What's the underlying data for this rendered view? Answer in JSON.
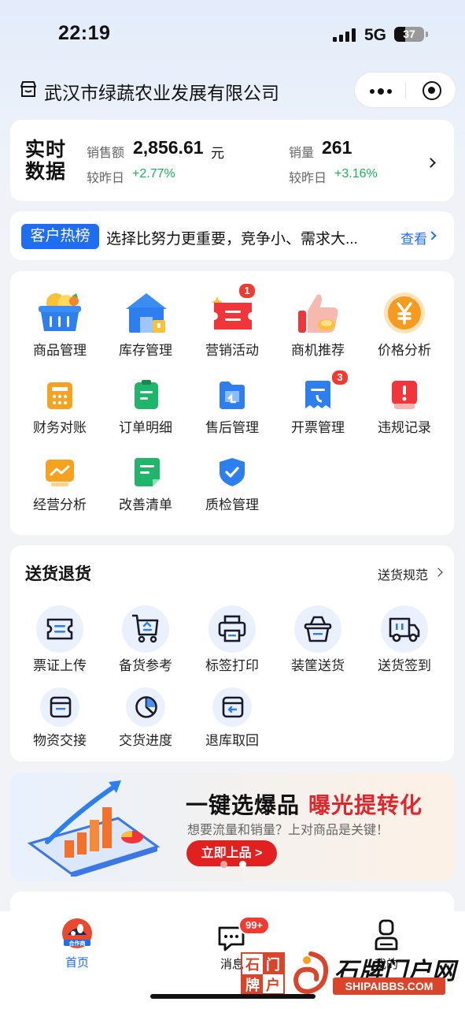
{
  "status_bar": {
    "time": "22:19",
    "network": "5G",
    "battery": "37"
  },
  "header": {
    "title": "武汉市绿蔬农业发展有限公司",
    "store_icon": "store-icon"
  },
  "realtime": {
    "label": "实时数据",
    "sales_label": "销售额",
    "sales_value": "2,856.61",
    "sales_unit": "元",
    "sales_compare_label": "较昨日",
    "sales_change": "+2.77%",
    "volume_label": "销量",
    "volume_value": "261",
    "volume_compare_label": "较昨日",
    "volume_change": "+3.16%"
  },
  "hot": {
    "tag": "客户热榜",
    "text": "选择比努力更重要，竞争小、需求大...",
    "link": "查看"
  },
  "grid": [
    {
      "label": "商品管理",
      "icon": "basket-icon"
    },
    {
      "label": "库存管理",
      "icon": "warehouse-icon"
    },
    {
      "label": "营销活动",
      "icon": "coupon-icon",
      "badge": "1"
    },
    {
      "label": "商机推荐",
      "icon": "thumbs-up-icon"
    },
    {
      "label": "价格分析",
      "icon": "yen-coin-icon"
    },
    {
      "label": "财务对账",
      "icon": "calculator-icon"
    },
    {
      "label": "订单明细",
      "icon": "order-list-icon"
    },
    {
      "label": "售后管理",
      "icon": "after-sales-icon"
    },
    {
      "label": "开票管理",
      "icon": "invoice-icon",
      "badge": "3"
    },
    {
      "label": "违规记录",
      "icon": "violation-icon"
    },
    {
      "label": "经营分析",
      "icon": "analytics-icon"
    },
    {
      "label": "改善清单",
      "icon": "improve-list-icon"
    },
    {
      "label": "质检管理",
      "icon": "shield-check-icon"
    }
  ],
  "delivery": {
    "title": "送货退货",
    "link": "送货规范",
    "items": [
      {
        "label": "票证上传",
        "icon": "ticket-upload-icon"
      },
      {
        "label": "备货参考",
        "icon": "cart-icon"
      },
      {
        "label": "标签打印",
        "icon": "printer-icon"
      },
      {
        "label": "装筐送货",
        "icon": "crate-icon"
      },
      {
        "label": "送货签到",
        "icon": "truck-icon"
      },
      {
        "label": "物资交接",
        "icon": "handover-icon"
      },
      {
        "label": "交货进度",
        "icon": "progress-pie-icon"
      },
      {
        "label": "退库取回",
        "icon": "return-icon"
      }
    ]
  },
  "banner": {
    "title_black": "一键选爆品",
    "title_red": "曝光提转化",
    "subtitle": "想要流量和销量？上对商品是关键！",
    "button": "立即上品 >"
  },
  "tabbar": {
    "home": "首页",
    "home_logo_text": "合作商",
    "messages": "消息",
    "messages_badge": "99+",
    "mine": "我的"
  },
  "watermark": {
    "box": [
      "石",
      "门",
      "牌",
      "户"
    ],
    "script": "石牌门户网",
    "url": "SHIPAIBBS.COM"
  },
  "colors": {
    "accent": "#1f6ef2",
    "positive": "#17b35a",
    "badge": "#f23b30",
    "promo_red": "#e3242b"
  }
}
